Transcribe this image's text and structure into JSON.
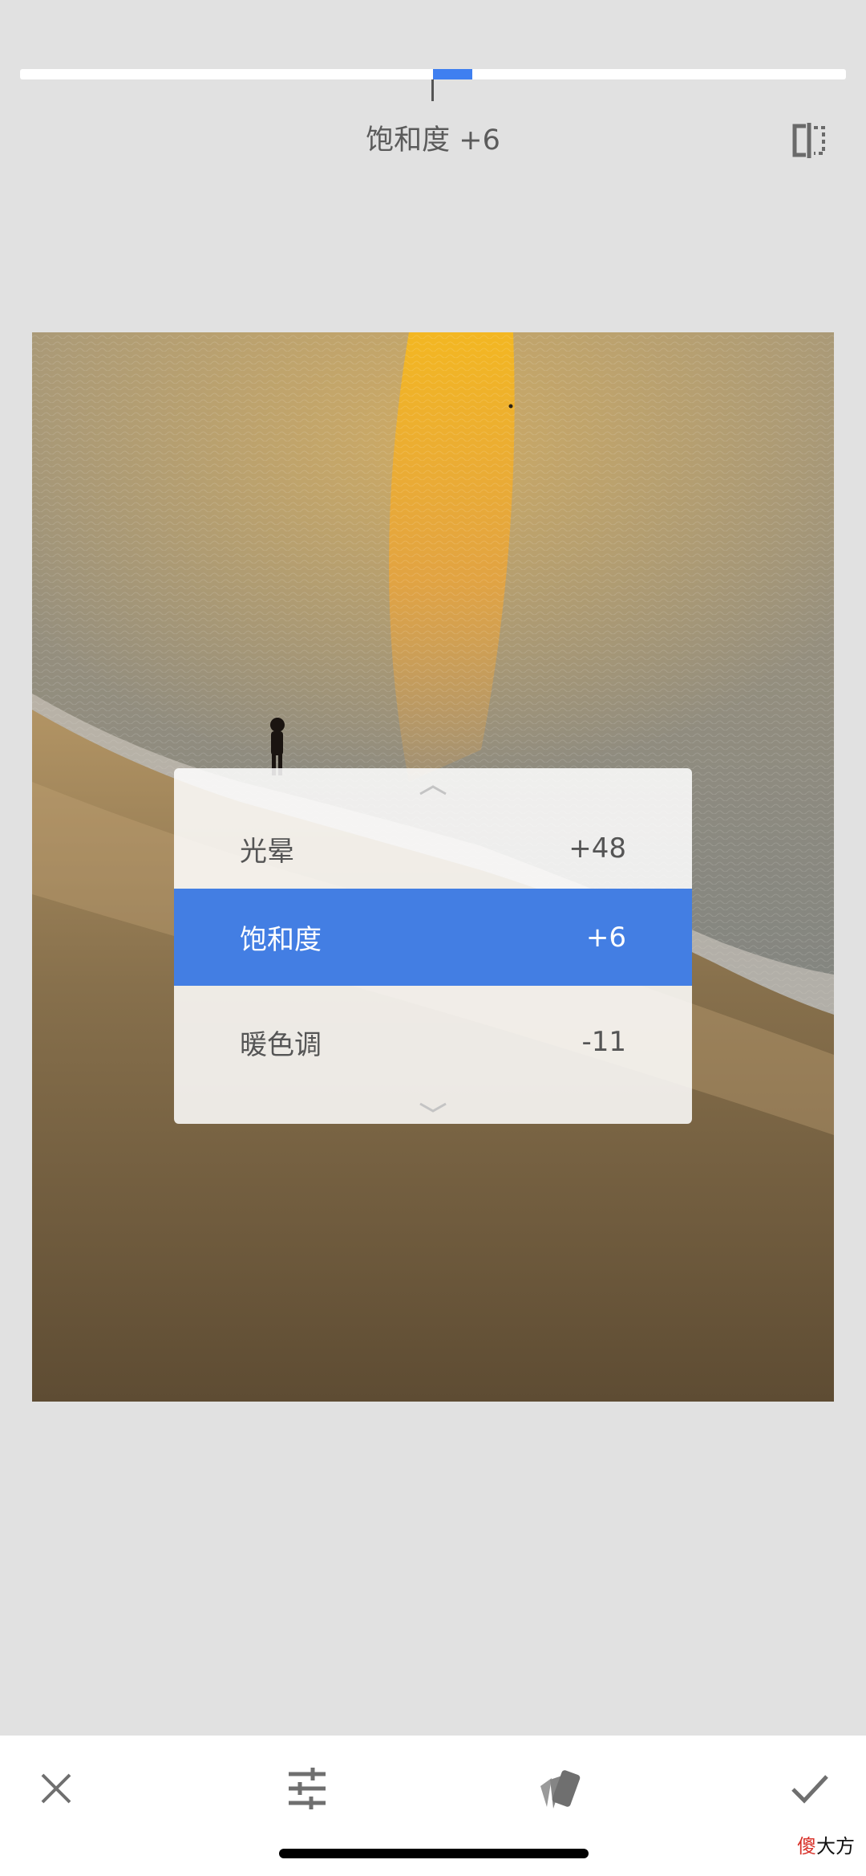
{
  "slider": {
    "value": 6,
    "min": -100,
    "max": 100
  },
  "adjustment_label": "饱和度 +6",
  "menu": {
    "items": [
      {
        "label": "光晕",
        "value": "+48",
        "active": false
      },
      {
        "label": "饱和度",
        "value": "+6",
        "active": true
      },
      {
        "label": "暖色调",
        "value": "-11",
        "active": false
      }
    ]
  },
  "watermark": {
    "red": "傻",
    "black": "大方"
  },
  "colors": {
    "accent": "#437ee3",
    "background": "#e1e1e1"
  },
  "icons": {
    "compare": "compare-icon",
    "close": "close-icon",
    "adjust": "sliders-icon",
    "styles": "styles-icon",
    "apply": "checkmark-icon"
  }
}
